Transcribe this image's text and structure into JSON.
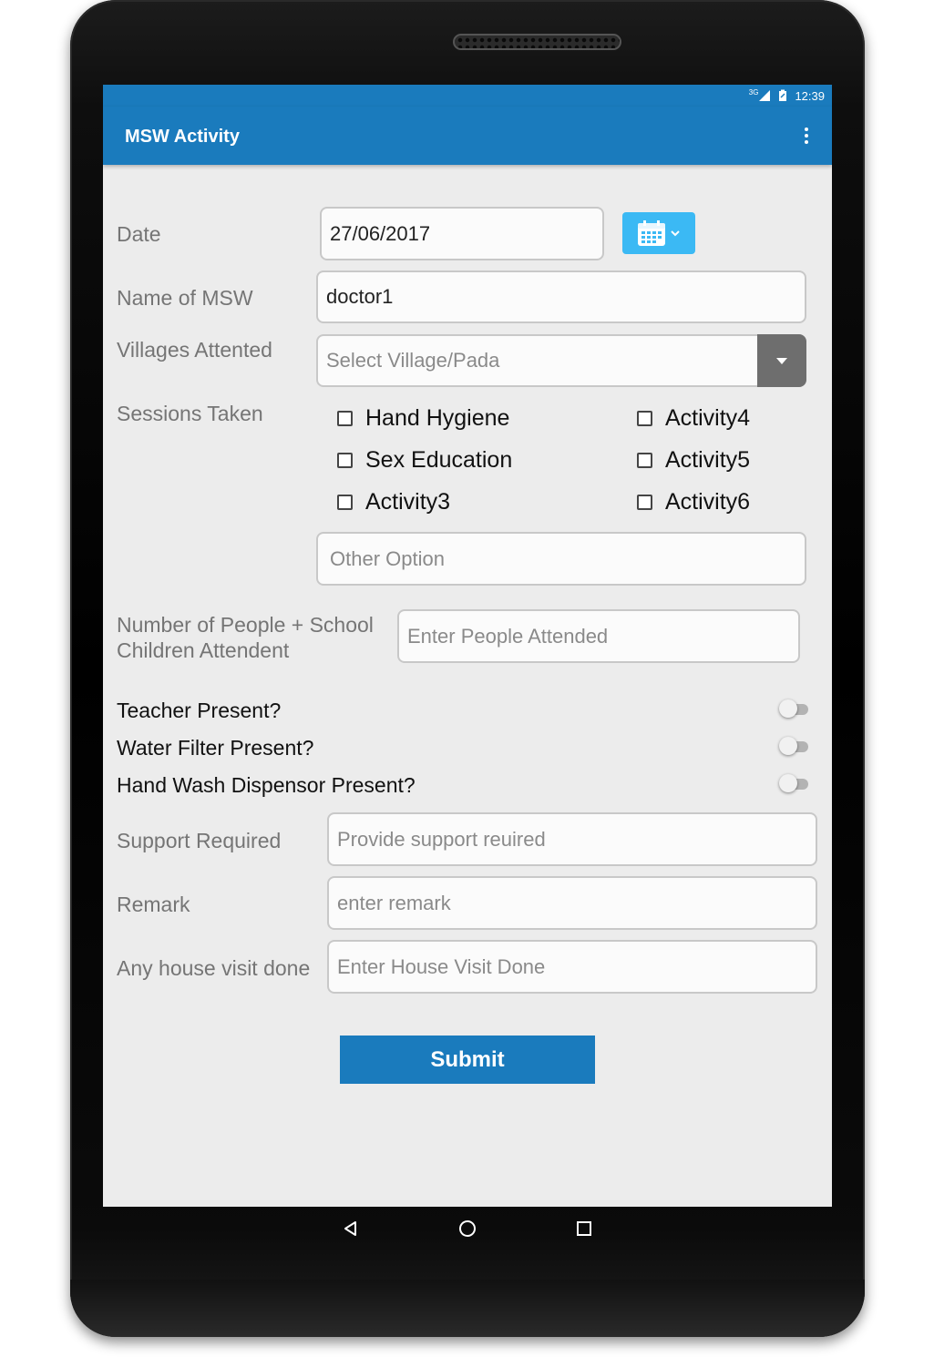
{
  "status_bar": {
    "time": "12:39",
    "network": "3G"
  },
  "app_bar": {
    "title": "MSW Activity",
    "menu_icon": "more-vert-icon"
  },
  "form": {
    "date": {
      "label": "Date",
      "value": "27/06/2017",
      "picker_icon": "calendar-icon"
    },
    "name": {
      "label": "Name of MSW",
      "value": "doctor1"
    },
    "villages": {
      "label": "Villages Attented",
      "placeholder": "Select Village/Pada"
    },
    "sessions": {
      "label": "Sessions Taken",
      "options": [
        {
          "label": "Hand Hygiene",
          "checked": false
        },
        {
          "label": "Sex Education",
          "checked": false
        },
        {
          "label": "Activity3",
          "checked": false
        },
        {
          "label": "Activity4",
          "checked": false
        },
        {
          "label": "Activity5",
          "checked": false
        },
        {
          "label": "Activity6",
          "checked": false
        }
      ],
      "other_placeholder": "Other Option"
    },
    "people": {
      "label_line1": "Number of People + School",
      "label_line2": "Children Attendent",
      "placeholder": "Enter People Attended"
    },
    "toggles": [
      {
        "label": "Teacher Present?",
        "on": false
      },
      {
        "label": "Water Filter Present?",
        "on": false
      },
      {
        "label": "Hand Wash Dispensor Present?",
        "on": false
      }
    ],
    "support": {
      "label": "Support Required",
      "placeholder": "Provide support reuired"
    },
    "remark": {
      "label": "Remark",
      "placeholder": "enter remark"
    },
    "house_visit": {
      "label": "Any house visit done",
      "placeholder": "Enter House Visit Done"
    },
    "submit_label": "Submit"
  },
  "colors": {
    "primary": "#1a7bbd",
    "calendar_button": "#3bb9f4",
    "background": "#ececec"
  }
}
